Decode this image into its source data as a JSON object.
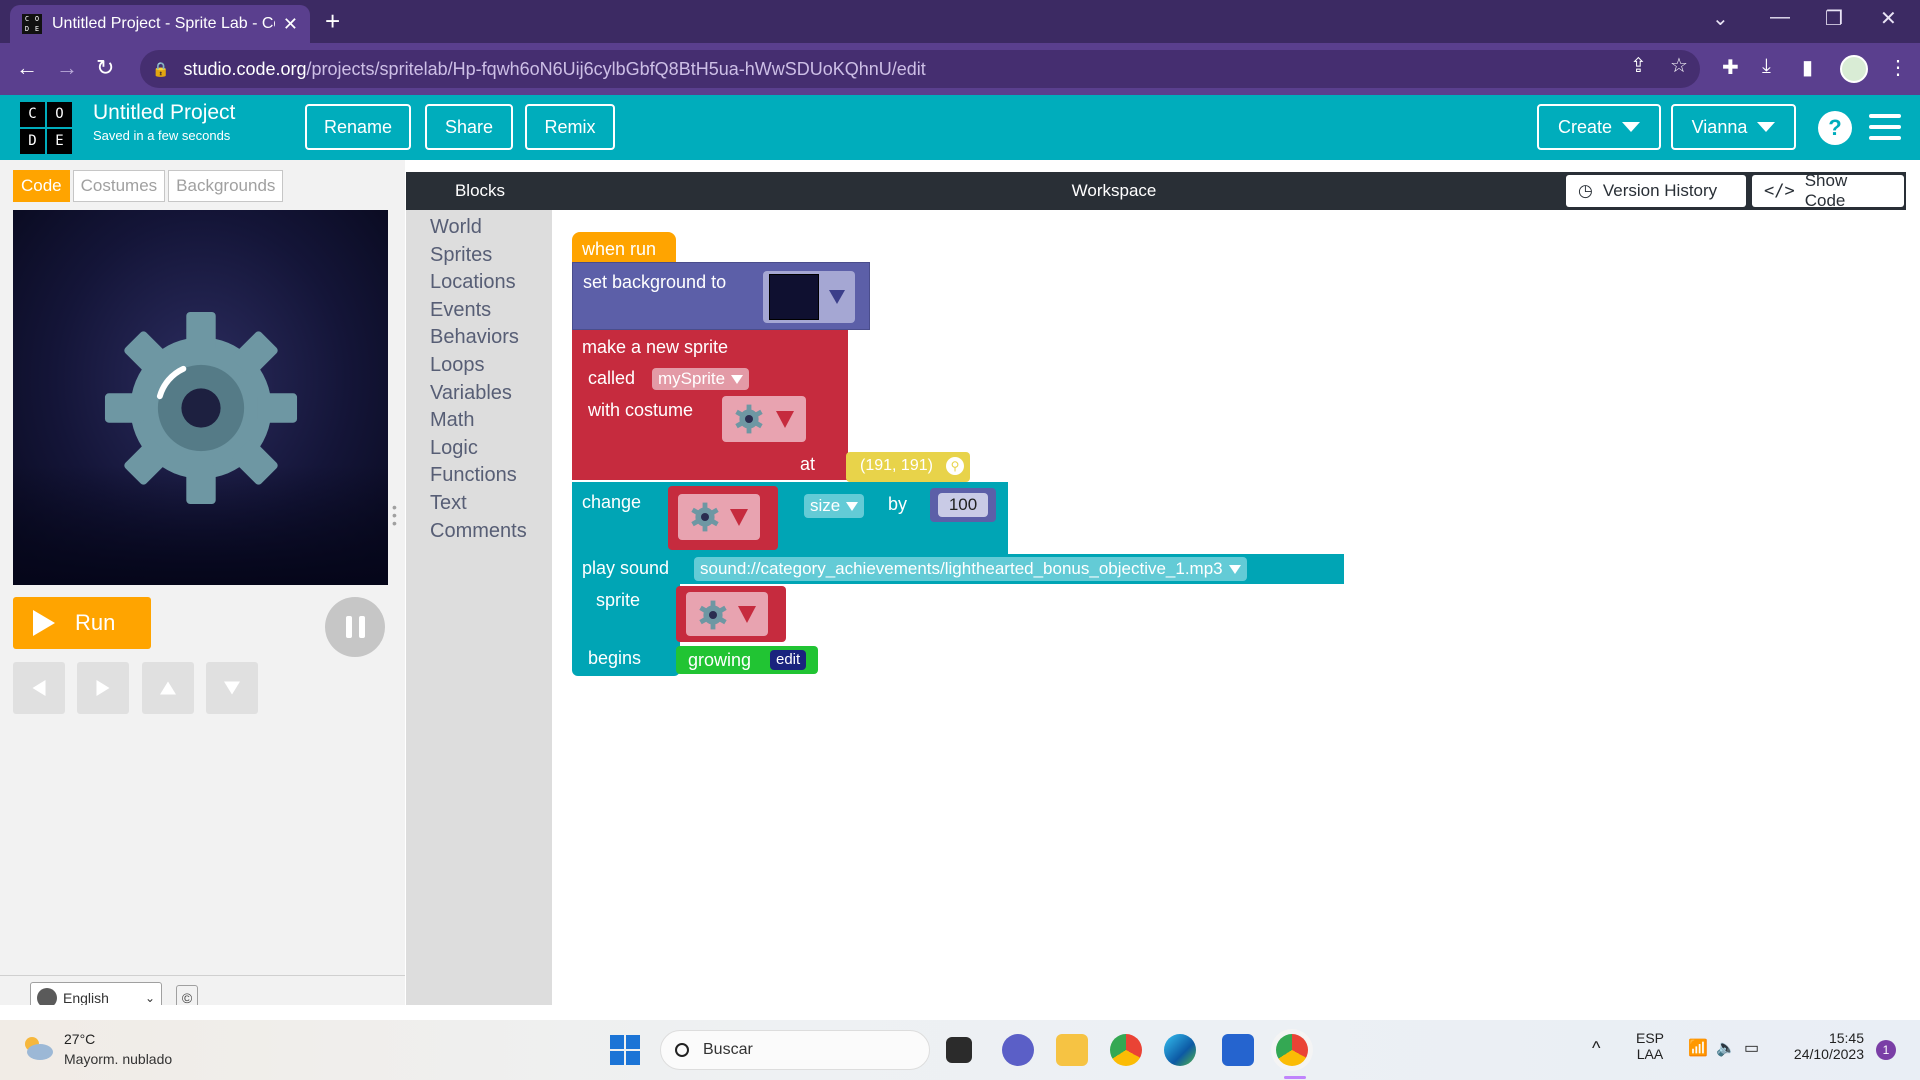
{
  "browser": {
    "tab_title": "Untitled Project - Sprite Lab - Co",
    "url_host": "studio.code.org",
    "url_path": "/projects/spritelab/Hp-fqwh6oN6Uij6cylbGbfQ8BtH5ua-hWwSDUoKQhnU/edit",
    "favicon_letters": [
      "C",
      "O",
      "D",
      "E"
    ]
  },
  "header": {
    "logo_letters": [
      "C",
      "O",
      "D",
      "E"
    ],
    "project_name": "Untitled Project",
    "saved_status": "Saved in a few seconds",
    "rename_label": "Rename",
    "share_label": "Share",
    "remix_label": "Remix",
    "create_label": "Create",
    "user_label": "Vianna",
    "help_label": "?"
  },
  "left_panel": {
    "tabs": [
      {
        "label": "Code",
        "active": true
      },
      {
        "label": "Costumes",
        "active": false
      },
      {
        "label": "Backgrounds",
        "active": false
      }
    ],
    "run_label": "Run",
    "language": "English",
    "cc_label": "©"
  },
  "toolbox": {
    "header": "Blocks",
    "categories": [
      "World",
      "Sprites",
      "Locations",
      "Events",
      "Behaviors",
      "Loops",
      "Variables",
      "Math",
      "Logic",
      "Functions",
      "Text",
      "Comments"
    ]
  },
  "workspace": {
    "title": "Workspace",
    "version_history_label": "Version History",
    "show_code_label": "Show Code"
  },
  "blocks": {
    "when_run": "when run",
    "set_background": "set background to",
    "make_sprite": "make a new sprite",
    "called": "called",
    "sprite_name": "mySprite",
    "with_costume": "with costume",
    "at": "at",
    "location": "(191, 191)",
    "change": "change",
    "property": "size",
    "by": "by",
    "amount": "100",
    "play_sound": "play sound",
    "sound": "sound://category_achievements/lighthearted_bonus_objective_1.mp3",
    "sprite": "sprite",
    "begins": "begins",
    "behavior": "growing",
    "edit": "edit"
  },
  "taskbar": {
    "temperature": "27°C",
    "weather": "Mayorm. nublado",
    "search_placeholder": "Buscar",
    "lang_top": "ESP",
    "lang_bottom": "LAA",
    "time": "15:45",
    "date": "24/10/2023",
    "notifications": "1"
  },
  "colors": {
    "header": "#00adbc",
    "run": "#ffa400",
    "events_block": "#ffa400",
    "world_block": "#5c5fa8",
    "sprite_block": "#c62b3e",
    "action_block": "#00a5b5",
    "location_block": "#e8d34a",
    "behavior_block": "#21c433"
  }
}
